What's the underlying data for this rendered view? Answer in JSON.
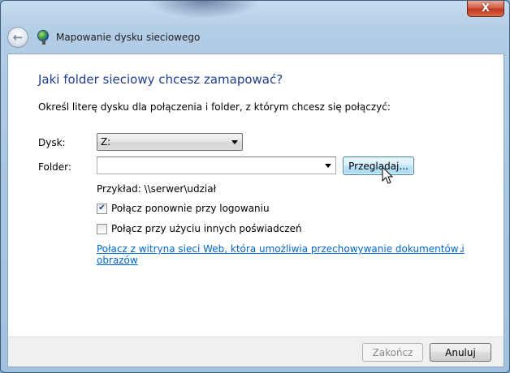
{
  "window": {
    "title": "Mapowanie dysku sieciowego",
    "close_label": "X",
    "back_icon": "back-arrow-icon",
    "app_icon": "network-drive-icon"
  },
  "content": {
    "heading": "Jaki folder sieciowy chcesz zamapować?",
    "instruction": "Określ literę dysku dla połączenia i folder, z którym chcesz się połączyć:",
    "drive_label": "Dysk:",
    "drive_value": "Z:",
    "folder_label": "Folder:",
    "folder_value": "",
    "browse_label": "Przeglądaj...",
    "example": "Przykład: \\\\serwer\\udział",
    "reconnect_label": "Połącz ponownie przy logowaniu",
    "reconnect_checked": true,
    "other_credentials_label": "Połącz przy użyciu innych poświadczeń",
    "other_credentials_checked": false,
    "link_text": "Połacz z witryna sieci Web, która umożliwia przechowywanie dokumentów i obrazów",
    "link_suffix": "."
  },
  "footer": {
    "finish_label": "Zakończ",
    "cancel_label": "Anuluj"
  },
  "colors": {
    "heading": "#1f3d8f",
    "link": "#0066cc",
    "close_button": "#c0391e"
  }
}
